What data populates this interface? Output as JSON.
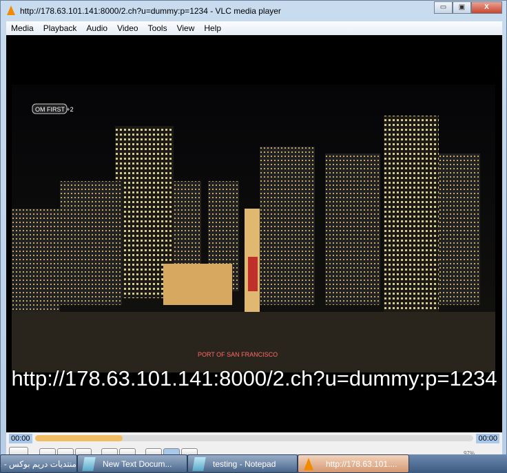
{
  "window": {
    "title": "http://178.63.101.141:8000/2.ch?u=dummy:p=1234 - VLC media player",
    "minimize": "▭",
    "maximize": "▣",
    "close": "X"
  },
  "menu": [
    "Media",
    "Playback",
    "Audio",
    "Video",
    "Tools",
    "View",
    "Help"
  ],
  "video": {
    "subtitle": "http://178.63.101.141:8000/2.ch?u=dummy:p=1234",
    "channel_logo": "OM FIRST +2",
    "sign_text": "PORT OF SAN FRANCISCO"
  },
  "seek": {
    "elapsed": "00:00",
    "total": "00:00",
    "progress_percent": 20
  },
  "controls": {
    "volume": "97%",
    "icons": [
      "pause-icon",
      "previous-icon",
      "stop-icon",
      "next-icon",
      "fullscreen-icon",
      "equalizer-icon",
      "playlist-icon",
      "loop-icon",
      "random-icon"
    ]
  },
  "taskbar": [
    {
      "label": "منتديات دريم بوكس - ...",
      "icon": "browser-icon"
    },
    {
      "label": "New Text Docum...",
      "icon": "notepad-icon"
    },
    {
      "label": "testing - Notepad",
      "icon": "notepad-icon"
    },
    {
      "label": "http://178.63.101....",
      "icon": "vlc-icon",
      "active": true
    }
  ]
}
